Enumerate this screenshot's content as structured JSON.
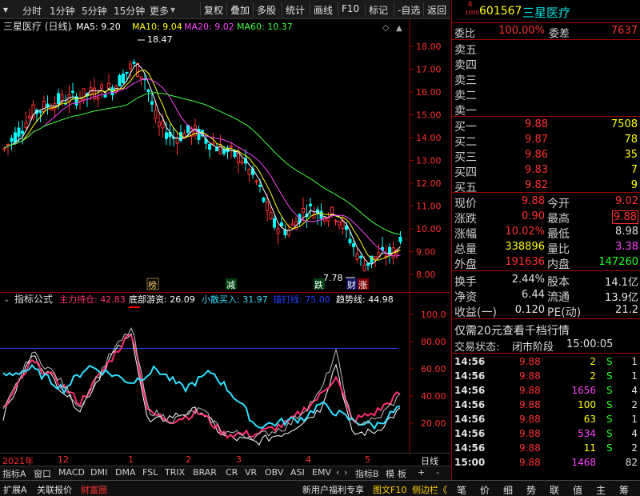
{
  "toolbar": {
    "periods": [
      "分时",
      "1分钟",
      "5分钟",
      "15分钟",
      "更多"
    ],
    "buttons": [
      "复权",
      "叠加",
      "多股",
      "统计",
      "画线",
      "F10",
      "标记",
      "-自选",
      "返回"
    ]
  },
  "main_chart": {
    "title": "三星医疗 (日线)",
    "ma": [
      {
        "label": "MA5: 9.20",
        "color": "#ffffff"
      },
      {
        "label": "MA10: 9.04",
        "color": "#ffff00"
      },
      {
        "label": "MA20: 9.02",
        "color": "#ff40ff"
      },
      {
        "label": "MA60: 10.37",
        "color": "#40ff40"
      }
    ],
    "y_ticks": [
      "18.00",
      "17.00",
      "16.00",
      "15.00",
      "14.00",
      "13.00",
      "12.00",
      "11.00",
      "10.00",
      "9.00",
      "8.00"
    ],
    "high_label": "18.47",
    "low_label": "7.78",
    "markers": [
      "榜",
      "减",
      "跌",
      "财",
      "涨"
    ]
  },
  "sub_chart": {
    "title": "指标公式",
    "lines": [
      {
        "label": "主力持仓: 42.83",
        "color": "#ff3070"
      },
      {
        "label": "底部游资: 26.09",
        "color": "#ffffff"
      },
      {
        "label": "小散买入: 31.97",
        "color": "#30e0ff"
      },
      {
        "label": "锚钉线: 75.00",
        "color": "#2040ff"
      },
      {
        "label": "趋势线: 44.98",
        "color": "#ffffff"
      }
    ],
    "y_ticks": [
      "100.0",
      "80.00",
      "60.00",
      "40.00",
      "20.00"
    ]
  },
  "date_axis": {
    "labels": [
      "2021年",
      "12",
      "1",
      "2",
      "3",
      "4",
      "5"
    ],
    "period": "日线"
  },
  "indicator_tabs": [
    "指标A",
    "窗口",
    "MACD",
    "DMI",
    "DMA",
    "FSL",
    "TRIX",
    "BRAR",
    "CR",
    "VR",
    "OBV",
    "ASI",
    "EMV"
  ],
  "indicator_extra": [
    "指标B",
    "模",
    "板",
    "+",
    "-"
  ],
  "bottom_bar": {
    "left": [
      "扩展A",
      "关联报价",
      "财富圈"
    ],
    "mid": [
      "新用户福利专享",
      "图文F10",
      "侧边栏《"
    ],
    "right_tabs": [
      "笔",
      "价",
      "细",
      "势",
      "联",
      "值",
      "主",
      "筹"
    ]
  },
  "quote": {
    "code_badge_top": "R",
    "code_badge_bottom": "1000",
    "code": "601567",
    "name": "三星医疗",
    "weibi_label": "委比",
    "weibi": "100.00%",
    "weicha_label": "委差",
    "weicha": "7637",
    "asks": [
      {
        "label": "卖五",
        "price": "",
        "vol": ""
      },
      {
        "label": "卖四",
        "price": "",
        "vol": ""
      },
      {
        "label": "卖三",
        "price": "",
        "vol": ""
      },
      {
        "label": "卖二",
        "price": "",
        "vol": ""
      },
      {
        "label": "卖一",
        "price": "",
        "vol": ""
      }
    ],
    "bids": [
      {
        "label": "买一",
        "price": "9.88",
        "vol": "7508"
      },
      {
        "label": "买二",
        "price": "9.87",
        "vol": "78"
      },
      {
        "label": "买三",
        "price": "9.86",
        "vol": "35"
      },
      {
        "label": "买四",
        "price": "9.83",
        "vol": "7"
      },
      {
        "label": "买五",
        "price": "9.82",
        "vol": "9"
      }
    ],
    "stats": [
      {
        "l1": "现价",
        "v1": "9.88",
        "c1": "r",
        "l2": "今开",
        "v2": "9.02",
        "c2": "r"
      },
      {
        "l1": "涨跌",
        "v1": "0.90",
        "c1": "r",
        "l2": "最高",
        "v2": "9.88",
        "c2": "r"
      },
      {
        "l1": "涨幅",
        "v1": "10.02%",
        "c1": "r",
        "l2": "最低",
        "v2": "8.98",
        "c2": "w"
      },
      {
        "l1": "总量",
        "v1": "338896",
        "c1": "y",
        "l2": "量比",
        "v2": "3.38",
        "c2": "m"
      },
      {
        "l1": "外盘",
        "v1": "191636",
        "c1": "r",
        "l2": "内盘",
        "v2": "147260",
        "c2": "g"
      }
    ],
    "fund": [
      {
        "l1": "换手",
        "v1": "2.44%",
        "l2": "股本",
        "v2": "14.1亿"
      },
      {
        "l1": "净资",
        "v1": "6.44",
        "l2": "流通",
        "v2": "13.9亿"
      },
      {
        "l1": "收益(一)",
        "v1": "0.120",
        "l2": "PE(动)",
        "v2": "21.2"
      }
    ],
    "promo": "仅需20元查看千档行情",
    "status_label": "交易状态:",
    "status": "闭市阶段",
    "status_time": "15:00:05",
    "ticks": [
      {
        "t": "14:56",
        "p": "9.88",
        "v": "2",
        "d": "S",
        "n": "1",
        "vc": "y"
      },
      {
        "t": "14:56",
        "p": "9.88",
        "v": "2",
        "d": "S",
        "n": "1",
        "vc": "y"
      },
      {
        "t": "14:56",
        "p": "9.88",
        "v": "1656",
        "d": "S",
        "n": "4",
        "vc": "m"
      },
      {
        "t": "14:56",
        "p": "9.88",
        "v": "100",
        "d": "S",
        "n": "2",
        "vc": "y"
      },
      {
        "t": "14:56",
        "p": "9.88",
        "v": "63",
        "d": "S",
        "n": "1",
        "vc": "y"
      },
      {
        "t": "14:56",
        "p": "9.88",
        "v": "534",
        "d": "S",
        "n": "4",
        "vc": "m"
      },
      {
        "t": "14:56",
        "p": "9.88",
        "v": "11",
        "d": "S",
        "n": "2",
        "vc": "y"
      },
      {
        "t": "15:00",
        "p": "9.88",
        "v": "1468",
        "d": "",
        "n": "82",
        "vc": "m"
      }
    ]
  },
  "colors": {
    "up": "#ff3030",
    "down": "#00ffff",
    "panel_border": "#a00000"
  }
}
